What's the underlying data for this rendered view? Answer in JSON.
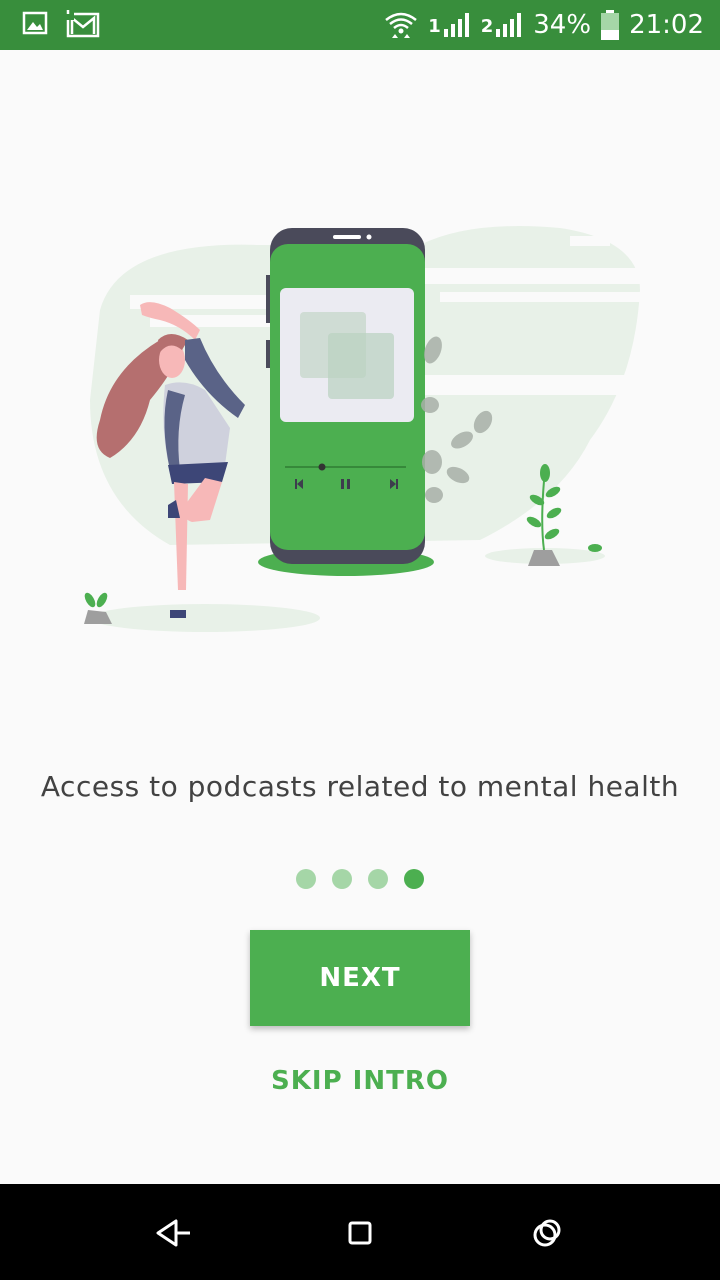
{
  "status_bar": {
    "battery": "34%",
    "time": "21:02",
    "sim1": "1",
    "sim2": "2",
    "icons": [
      "image-icon",
      "gmail-icon",
      "wifi-icon",
      "signal-icon",
      "battery-icon"
    ]
  },
  "onboarding": {
    "caption": "Access to podcasts related to mental health",
    "page_count": 4,
    "current_page": 4,
    "next_label": "NEXT",
    "skip_label": "SKIP INTRO"
  },
  "colors": {
    "status_bar": "#388e3c",
    "accent": "#4caf50",
    "dot_inactive": "#a5d6a7",
    "background": "#fafafa"
  },
  "nav_bar": {
    "icons": [
      "back-icon",
      "home-icon",
      "recents-icon"
    ]
  }
}
